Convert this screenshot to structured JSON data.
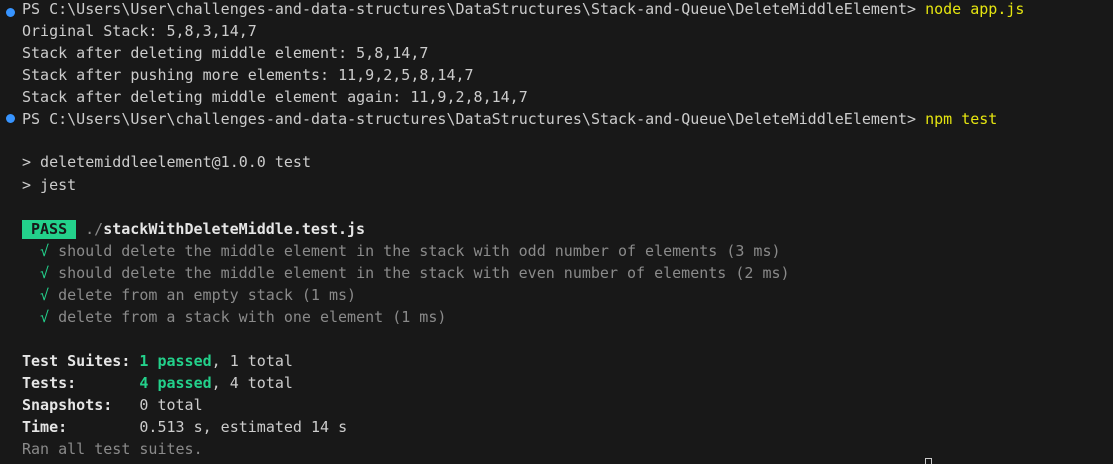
{
  "session": [
    {
      "prompt": "PS C:\\Users\\User\\challenges-and-data-structures\\DataStructures\\Stack-and-Queue\\DeleteMiddleElement>",
      "command": "node app.js"
    },
    {
      "prompt": "PS C:\\Users\\User\\challenges-and-data-structures\\DataStructures\\Stack-and-Queue\\DeleteMiddleElement>",
      "command": "npm test"
    }
  ],
  "app_output": [
    "Original Stack: 5,8,3,14,7",
    "Stack after deleting middle element: 5,8,14,7",
    "Stack after pushing more elements: 11,9,2,5,8,14,7",
    "Stack after deleting middle element again: 11,9,2,8,14,7"
  ],
  "npm_output": [
    "> deletemiddleelement@1.0.0 test",
    "> jest"
  ],
  "test_file": {
    "badge": "PASS",
    "dir": "./",
    "name": "stackWithDeleteMiddle.test.js"
  },
  "tests": [
    {
      "check": "√",
      "name": "should delete the middle element in the stack with odd number of elements (3 ms)"
    },
    {
      "check": "√",
      "name": "should delete the middle element in the stack with even number of elements (2 ms)"
    },
    {
      "check": "√",
      "name": "delete from an empty stack (1 ms)"
    },
    {
      "check": "√",
      "name": "delete from a stack with one element (1 ms)"
    }
  ],
  "summary": {
    "suites_label": "Test Suites: ",
    "suites_passed": "1 passed",
    "suites_rest": ", 1 total",
    "tests_label": "Tests:       ",
    "tests_passed": "4 passed",
    "tests_rest": ", 4 total",
    "snapshots_label": "Snapshots:   ",
    "snapshots_value": "0 total",
    "time_label": "Time:        ",
    "time_value": "0.513 s, estimated 14 s",
    "footer": "Ran all test suites."
  },
  "colors": {
    "background": "#181818",
    "prompt_dot": "#3794ff",
    "command": "#e5e510",
    "pass": "#23d18b"
  }
}
